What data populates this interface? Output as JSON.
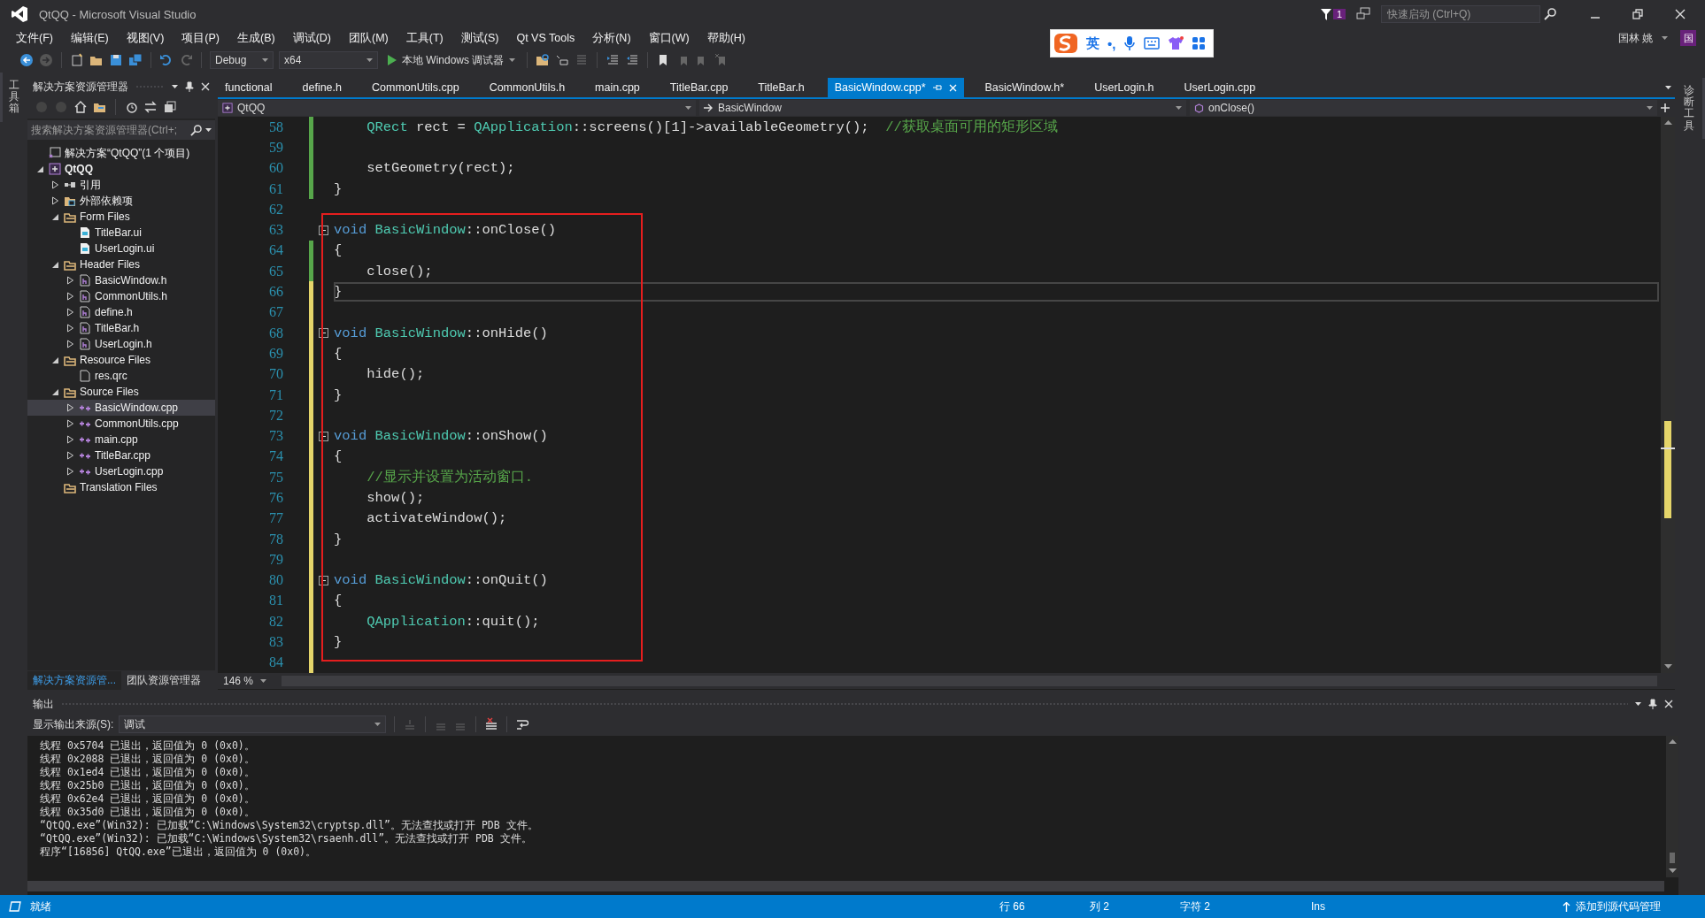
{
  "window": {
    "title": "QtQQ - Microsoft Visual Studio",
    "notification_count": "1",
    "quick_launch": {
      "placeholder": "快速启动 (Ctrl+Q)"
    },
    "user": {
      "name": "国林 姚",
      "avatar": "国"
    }
  },
  "menu": [
    "文件(F)",
    "编辑(E)",
    "视图(V)",
    "项目(P)",
    "生成(B)",
    "调试(D)",
    "团队(M)",
    "工具(T)",
    "测试(S)",
    "Qt VS Tools",
    "分析(N)",
    "窗口(W)",
    "帮助(H)"
  ],
  "toolbar": {
    "configuration": "Debug",
    "platform": "x64",
    "run": "本地 Windows 调试器"
  },
  "ime_bar": {
    "mode": "英",
    "punctuation": "•,"
  },
  "left_strip": "工具箱",
  "right_strip": "诊断工具",
  "solution_explorer": {
    "title": "解决方案资源管理器",
    "search": {
      "placeholder": "搜索解决方案资源管理器(Ctrl+;"
    },
    "tree": [
      {
        "label": "解决方案“QtQQ”(1 个项目)",
        "kind": "solution",
        "selected": false,
        "children": [
          {
            "label": "QtQQ",
            "kind": "project",
            "expanded": true,
            "selected": false,
            "children": [
              {
                "label": "引用",
                "kind": "references",
                "expanded": false,
                "selected": false
              },
              {
                "label": "外部依赖项",
                "kind": "external",
                "expanded": false,
                "selected": false
              },
              {
                "label": "Form Files",
                "kind": "folder",
                "expanded": true,
                "selected": false,
                "children": [
                  {
                    "label": "TitleBar.ui",
                    "kind": "ui",
                    "selected": false
                  },
                  {
                    "label": "UserLogin.ui",
                    "kind": "ui",
                    "selected": false
                  }
                ]
              },
              {
                "label": "Header Files",
                "kind": "folder",
                "expanded": true,
                "selected": false,
                "children": [
                  {
                    "label": "BasicWindow.h",
                    "kind": "header",
                    "expanded": false,
                    "selected": false
                  },
                  {
                    "label": "CommonUtils.h",
                    "kind": "header",
                    "expanded": false,
                    "selected": false
                  },
                  {
                    "label": "define.h",
                    "kind": "header",
                    "expanded": false,
                    "selected": false
                  },
                  {
                    "label": "TitleBar.h",
                    "kind": "header",
                    "expanded": false,
                    "selected": false
                  },
                  {
                    "label": "UserLogin.h",
                    "kind": "header",
                    "expanded": false,
                    "selected": false
                  }
                ]
              },
              {
                "label": "Resource Files",
                "kind": "folder",
                "expanded": true,
                "selected": false,
                "children": [
                  {
                    "label": "res.qrc",
                    "kind": "resource",
                    "selected": false
                  }
                ]
              },
              {
                "label": "Source Files",
                "kind": "folder",
                "expanded": true,
                "selected": false,
                "children": [
                  {
                    "label": "BasicWindow.cpp",
                    "kind": "source",
                    "expanded": false,
                    "selected": true
                  },
                  {
                    "label": "CommonUtils.cpp",
                    "kind": "source",
                    "expanded": false,
                    "selected": false
                  },
                  {
                    "label": "main.cpp",
                    "kind": "source",
                    "expanded": false,
                    "selected": false
                  },
                  {
                    "label": "TitleBar.cpp",
                    "kind": "source",
                    "expanded": false,
                    "selected": false
                  },
                  {
                    "label": "UserLogin.cpp",
                    "kind": "source",
                    "expanded": false,
                    "selected": false
                  }
                ]
              },
              {
                "label": "Translation Files",
                "kind": "folder",
                "selected": false
              }
            ]
          }
        ]
      }
    ],
    "bottom_tabs": [
      {
        "label": "解决方案资源管...",
        "selected": true
      },
      {
        "label": "团队资源管理器",
        "selected": false
      }
    ]
  },
  "editor": {
    "tabs": [
      {
        "label": "functional",
        "selected": false
      },
      {
        "label": "define.h",
        "selected": false
      },
      {
        "label": "CommonUtils.cpp",
        "selected": false
      },
      {
        "label": "CommonUtils.h",
        "selected": false
      },
      {
        "label": "main.cpp",
        "selected": false
      },
      {
        "label": "TitleBar.cpp",
        "selected": false
      },
      {
        "label": "TitleBar.h",
        "selected": false
      },
      {
        "label": "BasicWindow.cpp*",
        "selected": true
      },
      {
        "label": "BasicWindow.h*",
        "selected": false
      },
      {
        "label": "UserLogin.h",
        "selected": false
      },
      {
        "label": "UserLogin.cpp",
        "selected": false
      }
    ],
    "nav": {
      "project": "QtQQ",
      "class": "BasicWindow",
      "member": "onClose()"
    },
    "lines": [
      {
        "number": "58",
        "color": "#57a64a",
        "fold": false,
        "current": false,
        "tokens": [
          {
            "text": "    QRect",
            "kind": "type"
          },
          {
            "text": " rect = ",
            "kind": "plain"
          },
          {
            "text": "QApplication",
            "kind": "type"
          },
          {
            "text": "::screens()[1]->availableGeometry();  ",
            "kind": "plain"
          },
          {
            "text": "//获取桌面可用的矩形区域",
            "kind": "comment"
          }
        ]
      },
      {
        "number": "59",
        "color": "#57a64a",
        "fold": false,
        "current": false
      },
      {
        "number": "60",
        "color": "#57a64a",
        "fold": false,
        "current": false,
        "tokens": [
          {
            "text": "    setGeometry(rect);",
            "kind": "plain"
          }
        ]
      },
      {
        "number": "61",
        "color": "#57a64a",
        "fold": false,
        "current": false,
        "tokens": [
          {
            "text": "}",
            "kind": "plain"
          }
        ]
      },
      {
        "number": "62",
        "fold": false,
        "current": false
      },
      {
        "number": "63",
        "fold": true,
        "current": false,
        "tokens": [
          {
            "text": "void ",
            "kind": "keyword"
          },
          {
            "text": "BasicWindow",
            "kind": "type"
          },
          {
            "text": "::onClose()",
            "kind": "plain"
          }
        ]
      },
      {
        "number": "64",
        "color": "#57a64a",
        "fold": false,
        "current": false,
        "tokens": [
          {
            "text": "{",
            "kind": "plain"
          }
        ]
      },
      {
        "number": "65",
        "color": "#57a64a",
        "fold": false,
        "current": false,
        "tokens": [
          {
            "text": "    close();",
            "kind": "plain"
          }
        ]
      },
      {
        "number": "66",
        "color": "#e5d56a",
        "fold": false,
        "current": true,
        "tokens": [
          {
            "text": "}",
            "kind": "plain"
          }
        ]
      },
      {
        "number": "67",
        "color": "#e5d56a",
        "fold": false,
        "current": false
      },
      {
        "number": "68",
        "color": "#e5d56a",
        "fold": true,
        "current": false,
        "tokens": [
          {
            "text": "void ",
            "kind": "keyword"
          },
          {
            "text": "BasicWindow",
            "kind": "type"
          },
          {
            "text": "::onHide()",
            "kind": "plain"
          }
        ]
      },
      {
        "number": "69",
        "color": "#e5d56a",
        "fold": false,
        "current": false,
        "tokens": [
          {
            "text": "{",
            "kind": "plain"
          }
        ]
      },
      {
        "number": "70",
        "color": "#e5d56a",
        "fold": false,
        "current": false,
        "tokens": [
          {
            "text": "    hide();",
            "kind": "plain"
          }
        ]
      },
      {
        "number": "71",
        "color": "#e5d56a",
        "fold": false,
        "current": false,
        "tokens": [
          {
            "text": "}",
            "kind": "plain"
          }
        ]
      },
      {
        "number": "72",
        "color": "#e5d56a",
        "fold": false,
        "current": false
      },
      {
        "number": "73",
        "color": "#e5d56a",
        "fold": true,
        "current": false,
        "tokens": [
          {
            "text": "void ",
            "kind": "keyword"
          },
          {
            "text": "BasicWindow",
            "kind": "type"
          },
          {
            "text": "::onShow()",
            "kind": "plain"
          }
        ]
      },
      {
        "number": "74",
        "color": "#e5d56a",
        "fold": false,
        "current": false,
        "tokens": [
          {
            "text": "{",
            "kind": "plain"
          }
        ]
      },
      {
        "number": "75",
        "color": "#e5d56a",
        "fold": false,
        "current": false,
        "tokens": [
          {
            "text": "    //显示并设置为活动窗口.",
            "kind": "comment"
          }
        ]
      },
      {
        "number": "76",
        "color": "#e5d56a",
        "fold": false,
        "current": false,
        "tokens": [
          {
            "text": "    show();",
            "kind": "plain"
          }
        ]
      },
      {
        "number": "77",
        "color": "#e5d56a",
        "fold": false,
        "current": false,
        "tokens": [
          {
            "text": "    activateWindow();",
            "kind": "plain"
          }
        ]
      },
      {
        "number": "78",
        "color": "#e5d56a",
        "fold": false,
        "current": false,
        "tokens": [
          {
            "text": "}",
            "kind": "plain"
          }
        ]
      },
      {
        "number": "79",
        "color": "#e5d56a",
        "fold": false,
        "current": false
      },
      {
        "number": "80",
        "color": "#e5d56a",
        "fold": true,
        "current": false,
        "tokens": [
          {
            "text": "void ",
            "kind": "keyword"
          },
          {
            "text": "BasicWindow",
            "kind": "type"
          },
          {
            "text": "::onQuit()",
            "kind": "plain"
          }
        ]
      },
      {
        "number": "81",
        "color": "#e5d56a",
        "fold": false,
        "current": false,
        "tokens": [
          {
            "text": "{",
            "kind": "plain"
          }
        ]
      },
      {
        "number": "82",
        "color": "#e5d56a",
        "fold": false,
        "current": false,
        "tokens": [
          {
            "text": "    QApplication",
            "kind": "type"
          },
          {
            "text": "::quit();",
            "kind": "plain"
          }
        ]
      },
      {
        "number": "83",
        "color": "#e5d56a",
        "fold": false,
        "current": false,
        "tokens": [
          {
            "text": "}",
            "kind": "plain"
          }
        ]
      },
      {
        "number": "84",
        "color": "#e5d56a",
        "fold": false,
        "current": false
      }
    ],
    "zoom": "146 %"
  },
  "output": {
    "title": "输出",
    "source_label": "显示输出来源(S):",
    "source": "调试",
    "lines": [
      "线程 0x5704 已退出，返回值为 0 (0x0)。",
      "线程 0x2088 已退出，返回值为 0 (0x0)。",
      "线程 0x1ed4 已退出，返回值为 0 (0x0)。",
      "线程 0x25b0 已退出，返回值为 0 (0x0)。",
      "线程 0x62e4 已退出，返回值为 0 (0x0)。",
      "线程 0x35d0 已退出，返回值为 0 (0x0)。",
      "“QtQQ.exe”(Win32): 已加载“C:\\Windows\\System32\\cryptsp.dll”。无法查找或打开 PDB 文件。",
      "“QtQQ.exe”(Win32): 已加载“C:\\Windows\\System32\\rsaenh.dll”。无法查找或打开 PDB 文件。",
      "程序“[16856] QtQQ.exe”已退出，返回值为 0 (0x0)。"
    ]
  },
  "status_bar": {
    "message": "就绪",
    "line": "行 66",
    "column": "列 2",
    "char": "字符 2",
    "mode": "Ins",
    "source_control": "添加到源代码管理"
  }
}
